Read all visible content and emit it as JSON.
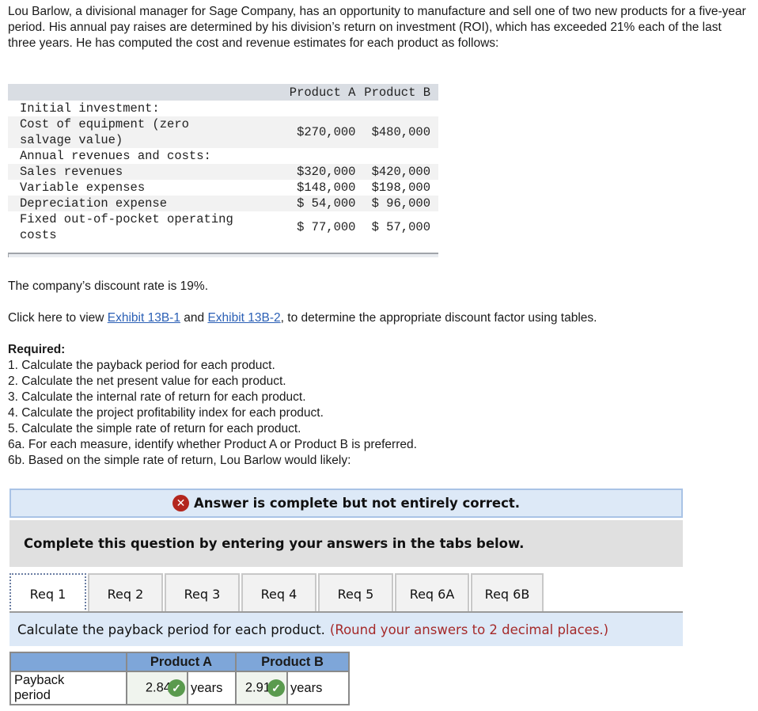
{
  "intro": "Lou Barlow, a divisional manager for Sage Company, has an opportunity to manufacture and sell one of two new products for a five-year period. His annual pay raises are determined by his division’s return on investment (ROI), which has exceeded 21% each of the last three years. He has computed the cost and revenue estimates for each product as follows:",
  "data_table": {
    "headers": [
      "",
      "Product A",
      "Product B"
    ],
    "rows": [
      {
        "label": "Initial investment:",
        "a": "",
        "b": ""
      },
      {
        "label": "Cost of equipment (zero salvage value)",
        "a": "$270,000",
        "b": "$480,000"
      },
      {
        "label": "Annual revenues and costs:",
        "a": "",
        "b": ""
      },
      {
        "label": "Sales revenues",
        "a": "$320,000",
        "b": "$420,000"
      },
      {
        "label": "Variable expenses",
        "a": "$148,000",
        "b": "$198,000"
      },
      {
        "label": "Depreciation expense",
        "a": "$ 54,000",
        "b": "$ 96,000"
      },
      {
        "label": "Fixed out-of-pocket operating costs",
        "a": "$ 77,000",
        "b": "$ 57,000"
      }
    ]
  },
  "discount_text": "The company’s discount rate is 19%.",
  "exhibit": {
    "prefix": "Click here to view ",
    "link1": "Exhibit 13B-1",
    "middle": " and ",
    "link2": "Exhibit 13B-2",
    "suffix": ", to determine the appropriate discount factor using tables."
  },
  "required": {
    "title": "Required:",
    "items": [
      "1. Calculate the payback period for each product.",
      "2. Calculate the net present value for each product.",
      "3. Calculate the internal rate of return for each product.",
      "4. Calculate the project profitability index for each product.",
      "5. Calculate the simple rate of return for each product.",
      "6a. For each measure, identify whether Product A or Product B is preferred.",
      "6b. Based on the simple rate of return, Lou Barlow would likely:"
    ]
  },
  "status": {
    "icon": "x-circle-icon",
    "text": "Answer is complete but not entirely correct.",
    "color": "#b3261e"
  },
  "instruction": "Complete this question by entering your answers in the tabs below.",
  "tabs": [
    {
      "label": "Req 1",
      "active": true
    },
    {
      "label": "Req 2",
      "active": false
    },
    {
      "label": "Req 3",
      "active": false
    },
    {
      "label": "Req 4",
      "active": false
    },
    {
      "label": "Req 5",
      "active": false
    },
    {
      "label": "Req 6A",
      "active": false
    },
    {
      "label": "Req 6B",
      "active": false
    }
  ],
  "panel": {
    "prompt": "Calculate the payback period for each product.",
    "hint": "(Round your answers to 2 decimal places.)",
    "hint_color": "#a52a2a"
  },
  "answer_table": {
    "headers": [
      "",
      "Product A",
      "Product B"
    ],
    "row_label": "Payback period",
    "a_value": "2.84",
    "a_unit": "years",
    "a_status": "correct",
    "b_value": "2.91",
    "b_unit": "years",
    "b_status": "correct",
    "check_glyph": "✓"
  }
}
